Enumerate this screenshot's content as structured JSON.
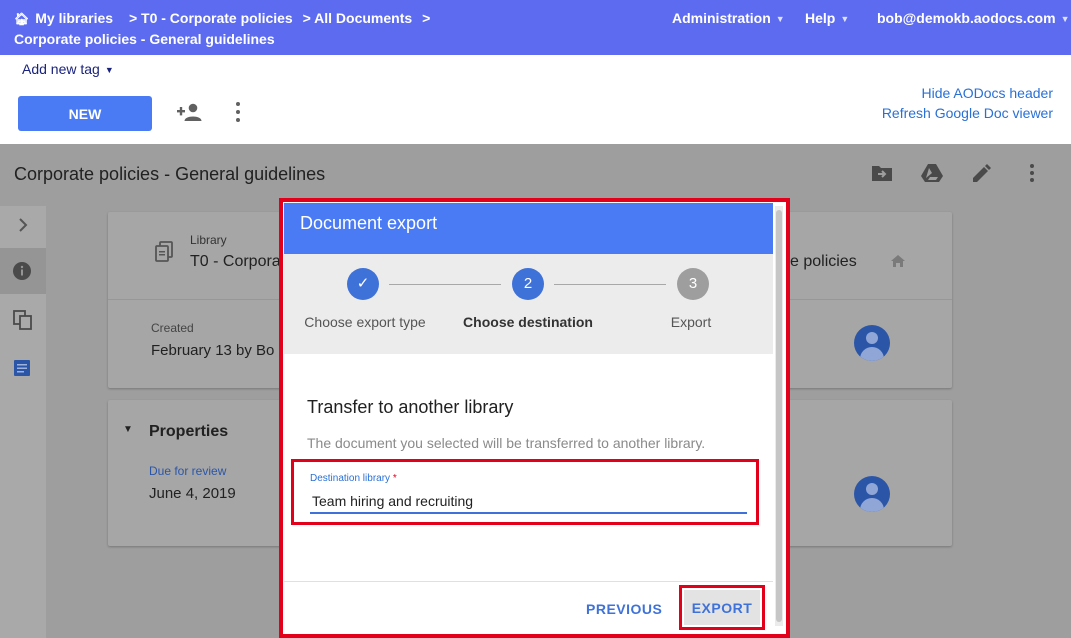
{
  "topbar": {
    "breadcrumb": [
      "My libraries",
      "> T0 - Corporate policies",
      "> All Documents",
      ">",
      "Corporate policies - General guidelines"
    ],
    "menu_admin": "Administration",
    "menu_help": "Help",
    "menu_user": "bob@demokb.aodocs.com"
  },
  "header": {
    "add_tag": "Add new tag",
    "new_button": "NEW",
    "hide_header_link": "Hide AODocs header",
    "refresh_link": "Refresh Google Doc viewer"
  },
  "document": {
    "title": "Corporate policies - General guidelines",
    "library_label": "Library",
    "library_value": "T0 - Corpora",
    "library_value_right": "e policies",
    "created_label": "Created",
    "created_value": "February 13 by Bo",
    "properties_title": "Properties",
    "due_label": "Due for review",
    "due_value": "June 4, 2019"
  },
  "dialog": {
    "title": "Document export",
    "steps": [
      {
        "label": "Choose export type",
        "status": "done",
        "symbol": "✓"
      },
      {
        "label": "Choose destination",
        "status": "active",
        "symbol": "2"
      },
      {
        "label": "Export",
        "status": "pending",
        "symbol": "3"
      }
    ],
    "section_title": "Transfer to another library",
    "description": "The document you selected will be transferred to another library.",
    "field_label": "Destination library",
    "field_required_mark": "*",
    "field_value": "Team hiring and recruiting",
    "previous_button": "PREVIOUS",
    "export_button": "EXPORT"
  },
  "colors": {
    "topbar": "#5c6bf0",
    "primary": "#4a7bf5",
    "highlight": "#e3001b",
    "step_done": "#3f72d8",
    "step_pending": "#9e9e9e"
  }
}
